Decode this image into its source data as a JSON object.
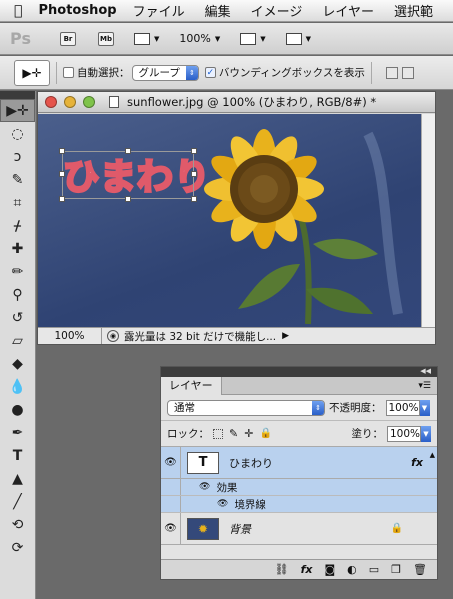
{
  "menubar": {
    "app_name": "Photoshop",
    "items": [
      "ファイル",
      "編集",
      "イメージ",
      "レイヤー",
      "選択範"
    ]
  },
  "appbar": {
    "logo": "Ps",
    "bridge": "Br",
    "minibridge": "Mb",
    "zoom": "100%"
  },
  "options": {
    "auto_select_label": "自動選択：",
    "auto_select_value": "グループ",
    "bounding_box_label": "バウンディングボックスを表示"
  },
  "document": {
    "title": "sunflower.jpg @ 100% (ひまわり, RGB/8#) *",
    "zoom": "100%",
    "status_text": "露光量は 32 bit だけで機能し...",
    "canvas_text": "ひまわり",
    "colors": {
      "sky": "#34497a",
      "petal": "#e8b21c",
      "text_fill": "#ffffff",
      "text_stroke": "#e05a6a"
    }
  },
  "layers_panel": {
    "tab": "レイヤー",
    "blend_mode": "通常",
    "opacity_label": "不透明度：",
    "opacity_value": "100%",
    "lock_label": "ロック：",
    "fill_label": "塗り：",
    "fill_value": "100%",
    "layers": [
      {
        "name": "ひまわり",
        "thumb": "T",
        "fx": "fx",
        "selected": true
      },
      {
        "name": "背景",
        "selected": false
      }
    ],
    "effects_label": "効果",
    "stroke_effect_label": "境界線"
  }
}
